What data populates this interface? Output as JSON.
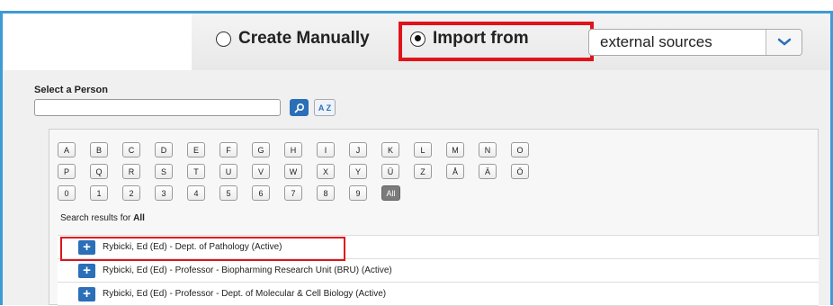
{
  "mode_selector": {
    "create_manually_label": "Create Manually",
    "import_from_label": "Import from",
    "source_dropdown_value": "external sources",
    "selected": "import_from"
  },
  "person_search": {
    "label": "Select a Person",
    "input_value": "",
    "az_label": "A Z"
  },
  "alphabet": {
    "row1": [
      "A",
      "B",
      "C",
      "D",
      "E",
      "F",
      "G",
      "H",
      "I",
      "J",
      "K",
      "L",
      "M",
      "N",
      "O"
    ],
    "row2": [
      "P",
      "Q",
      "R",
      "S",
      "T",
      "U",
      "V",
      "W",
      "X",
      "Y",
      "Ü",
      "Z",
      "Å",
      "Ä",
      "Ö"
    ],
    "row3": [
      "0",
      "1",
      "2",
      "3",
      "4",
      "5",
      "6",
      "7",
      "8",
      "9",
      "All"
    ],
    "active": "All"
  },
  "results": {
    "prefix": "Search results for ",
    "query": "All",
    "items": [
      "Rybicki, Ed (Ed) - Dept. of Pathology (Active)",
      "Rybicki, Ed (Ed) - Professor - Biopharming Research Unit (BRU) (Active)",
      "Rybicki, Ed (Ed) - Professor - Dept. of Molecular & Cell Biology (Active)"
    ]
  },
  "colors": {
    "accent_blue": "#2a6fb8",
    "frame_blue": "#3d9bd6",
    "highlight_red": "#e0141b"
  }
}
